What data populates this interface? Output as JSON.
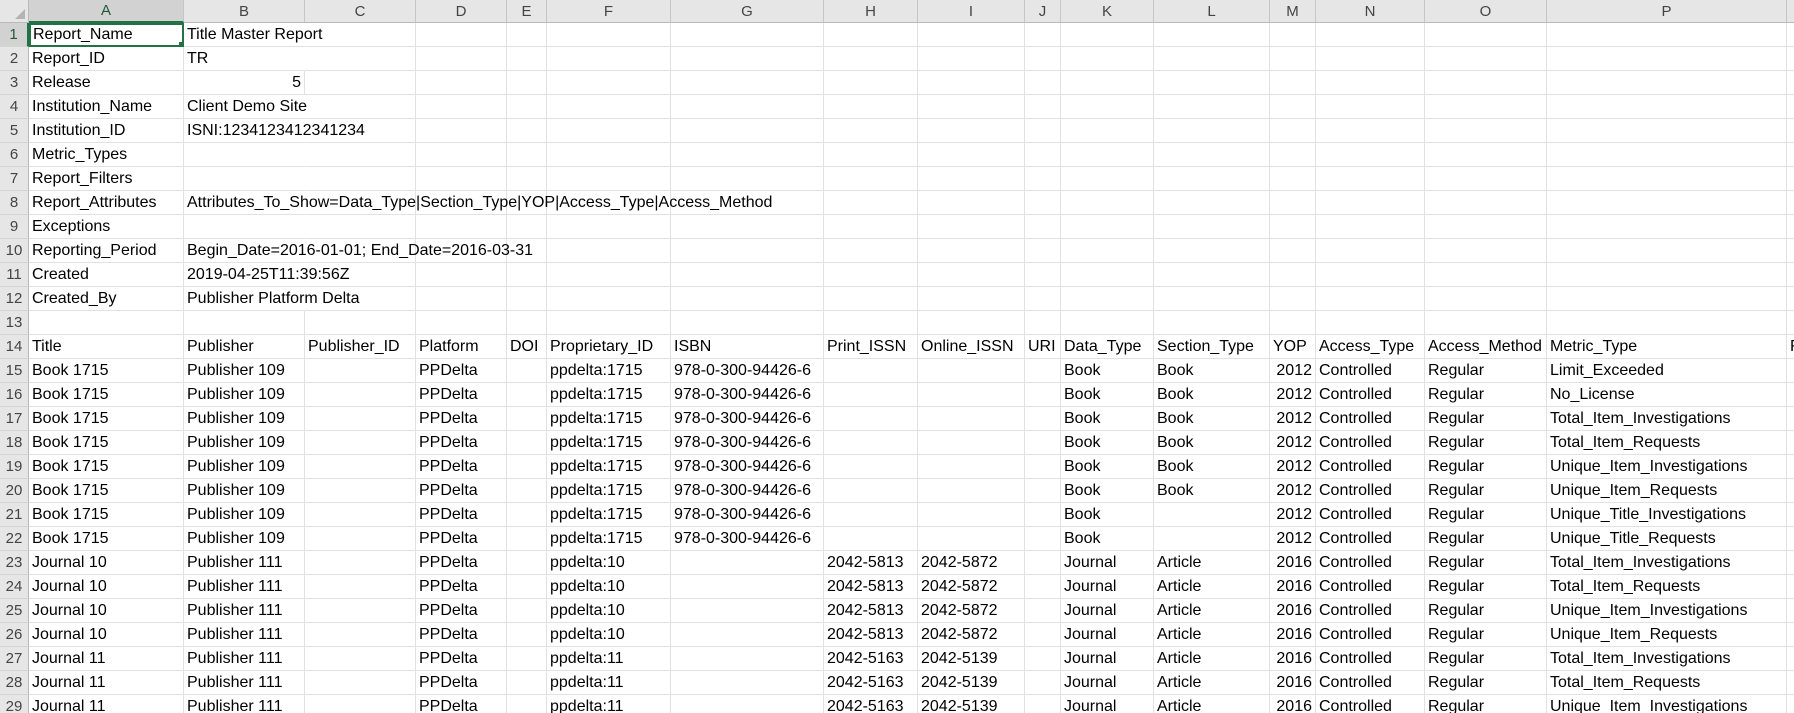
{
  "columns": [
    {
      "letter": "A",
      "w": 155
    },
    {
      "letter": "B",
      "w": 121
    },
    {
      "letter": "C",
      "w": 111
    },
    {
      "letter": "D",
      "w": 91
    },
    {
      "letter": "E",
      "w": 40
    },
    {
      "letter": "F",
      "w": 124
    },
    {
      "letter": "G",
      "w": 153
    },
    {
      "letter": "H",
      "w": 94
    },
    {
      "letter": "I",
      "w": 107
    },
    {
      "letter": "J",
      "w": 36
    },
    {
      "letter": "K",
      "w": 93
    },
    {
      "letter": "L",
      "w": 116
    },
    {
      "letter": "M",
      "w": 46
    },
    {
      "letter": "N",
      "w": 109
    },
    {
      "letter": "O",
      "w": 122
    },
    {
      "letter": "P",
      "w": 240
    },
    {
      "letter": "",
      "w": 26
    }
  ],
  "header_rows": [
    [
      "Report_Name",
      "Title Master Report"
    ],
    [
      "Report_ID",
      "TR"
    ],
    [
      "Release",
      "5"
    ],
    [
      "Institution_Name",
      "Client Demo Site"
    ],
    [
      "Institution_ID",
      "ISNI:1234123412341234"
    ],
    [
      "Metric_Types",
      ""
    ],
    [
      "Report_Filters",
      ""
    ],
    [
      "Report_Attributes",
      "Attributes_To_Show=Data_Type|Section_Type|YOP|Access_Type|Access_Method"
    ],
    [
      "Exceptions",
      ""
    ],
    [
      "Reporting_Period",
      "Begin_Date=2016-01-01; End_Date=2016-03-31"
    ],
    [
      "Created",
      "2019-04-25T11:39:56Z"
    ],
    [
      "Created_By",
      "Publisher Platform Delta"
    ]
  ],
  "table_header": [
    "Title",
    "Publisher",
    "Publisher_ID",
    "Platform",
    "DOI",
    "Proprietary_ID",
    "ISBN",
    "Print_ISSN",
    "Online_ISSN",
    "URI",
    "Data_Type",
    "Section_Type",
    "YOP",
    "Access_Type",
    "Access_Method",
    "Metric_Type",
    "R"
  ],
  "table_rows": [
    [
      "Book 1715",
      "Publisher 109",
      "",
      "PPDelta",
      "",
      "ppdelta:1715",
      "978-0-300-94426-6",
      "",
      "",
      "",
      "Book",
      "Book",
      "2012",
      "Controlled",
      "Regular",
      "Limit_Exceeded"
    ],
    [
      "Book 1715",
      "Publisher 109",
      "",
      "PPDelta",
      "",
      "ppdelta:1715",
      "978-0-300-94426-6",
      "",
      "",
      "",
      "Book",
      "Book",
      "2012",
      "Controlled",
      "Regular",
      "No_License"
    ],
    [
      "Book 1715",
      "Publisher 109",
      "",
      "PPDelta",
      "",
      "ppdelta:1715",
      "978-0-300-94426-6",
      "",
      "",
      "",
      "Book",
      "Book",
      "2012",
      "Controlled",
      "Regular",
      "Total_Item_Investigations"
    ],
    [
      "Book 1715",
      "Publisher 109",
      "",
      "PPDelta",
      "",
      "ppdelta:1715",
      "978-0-300-94426-6",
      "",
      "",
      "",
      "Book",
      "Book",
      "2012",
      "Controlled",
      "Regular",
      "Total_Item_Requests"
    ],
    [
      "Book 1715",
      "Publisher 109",
      "",
      "PPDelta",
      "",
      "ppdelta:1715",
      "978-0-300-94426-6",
      "",
      "",
      "",
      "Book",
      "Book",
      "2012",
      "Controlled",
      "Regular",
      "Unique_Item_Investigations"
    ],
    [
      "Book 1715",
      "Publisher 109",
      "",
      "PPDelta",
      "",
      "ppdelta:1715",
      "978-0-300-94426-6",
      "",
      "",
      "",
      "Book",
      "Book",
      "2012",
      "Controlled",
      "Regular",
      "Unique_Item_Requests"
    ],
    [
      "Book 1715",
      "Publisher 109",
      "",
      "PPDelta",
      "",
      "ppdelta:1715",
      "978-0-300-94426-6",
      "",
      "",
      "",
      "Book",
      "",
      "2012",
      "Controlled",
      "Regular",
      "Unique_Title_Investigations"
    ],
    [
      "Book 1715",
      "Publisher 109",
      "",
      "PPDelta",
      "",
      "ppdelta:1715",
      "978-0-300-94426-6",
      "",
      "",
      "",
      "Book",
      "",
      "2012",
      "Controlled",
      "Regular",
      "Unique_Title_Requests"
    ],
    [
      "Journal 10",
      "Publisher 111",
      "",
      "PPDelta",
      "",
      "ppdelta:10",
      "",
      "2042-5813",
      "2042-5872",
      "",
      "Journal",
      "Article",
      "2016",
      "Controlled",
      "Regular",
      "Total_Item_Investigations"
    ],
    [
      "Journal 10",
      "Publisher 111",
      "",
      "PPDelta",
      "",
      "ppdelta:10",
      "",
      "2042-5813",
      "2042-5872",
      "",
      "Journal",
      "Article",
      "2016",
      "Controlled",
      "Regular",
      "Total_Item_Requests"
    ],
    [
      "Journal 10",
      "Publisher 111",
      "",
      "PPDelta",
      "",
      "ppdelta:10",
      "",
      "2042-5813",
      "2042-5872",
      "",
      "Journal",
      "Article",
      "2016",
      "Controlled",
      "Regular",
      "Unique_Item_Investigations"
    ],
    [
      "Journal 10",
      "Publisher 111",
      "",
      "PPDelta",
      "",
      "ppdelta:10",
      "",
      "2042-5813",
      "2042-5872",
      "",
      "Journal",
      "Article",
      "2016",
      "Controlled",
      "Regular",
      "Unique_Item_Requests"
    ],
    [
      "Journal 11",
      "Publisher 111",
      "",
      "PPDelta",
      "",
      "ppdelta:11",
      "",
      "2042-5163",
      "2042-5139",
      "",
      "Journal",
      "Article",
      "2016",
      "Controlled",
      "Regular",
      "Total_Item_Investigations"
    ],
    [
      "Journal 11",
      "Publisher 111",
      "",
      "PPDelta",
      "",
      "ppdelta:11",
      "",
      "2042-5163",
      "2042-5139",
      "",
      "Journal",
      "Article",
      "2016",
      "Controlled",
      "Regular",
      "Total_Item_Requests"
    ],
    [
      "Journal 11",
      "Publisher 111",
      "",
      "PPDelta",
      "",
      "ppdelta:11",
      "",
      "2042-5163",
      "2042-5139",
      "",
      "Journal",
      "Article",
      "2016",
      "Controlled",
      "Regular",
      "Unique_Item_Investigations"
    ]
  ],
  "selected_cell": "A1",
  "colors": {
    "header_bg": "#e6e6e6",
    "grid": "#e1e1e1",
    "accent": "#217346"
  }
}
